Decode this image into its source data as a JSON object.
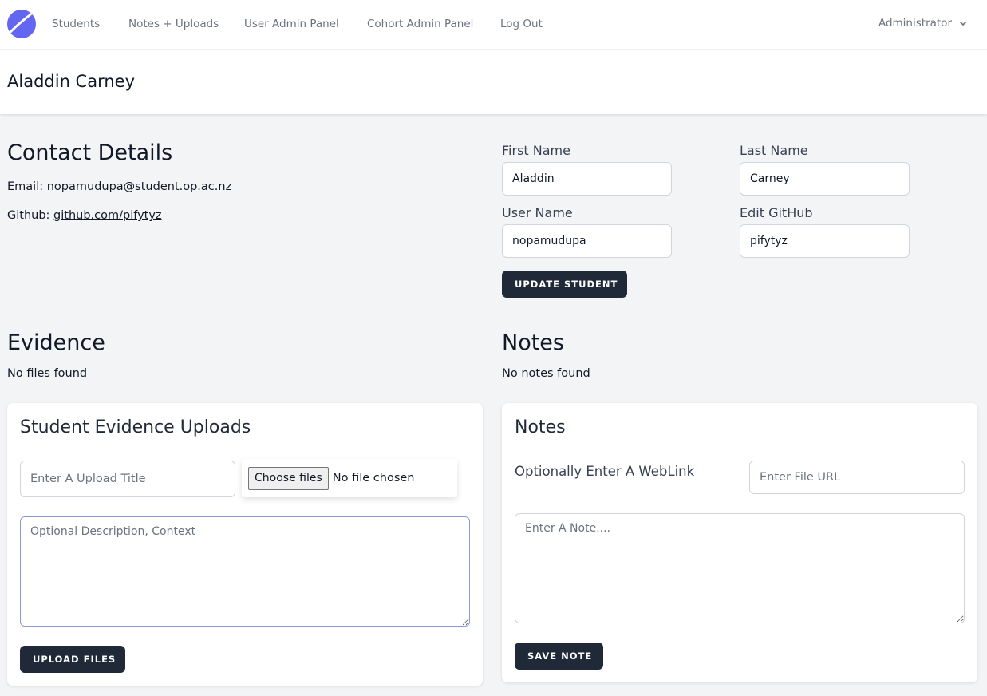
{
  "nav": {
    "links": [
      "Students",
      "Notes + Uploads",
      "User Admin Panel",
      "Cohort Admin Panel",
      "Log Out"
    ],
    "user": "Administrator",
    "logo_icon": "moon-logo-icon",
    "brand_color": "#6366f1"
  },
  "page": {
    "title": "Aladdin Carney"
  },
  "contact": {
    "heading": "Contact Details",
    "email_label": "Email:",
    "email": "nopamudupa@student.op.ac.nz",
    "github_label": "Github:",
    "github": "github.com/pifytyz"
  },
  "student_form": {
    "first_name_label": "First Name",
    "first_name": "Aladdin",
    "last_name_label": "Last Name",
    "last_name": "Carney",
    "user_name_label": "User Name",
    "user_name": "nopamudupa",
    "github_label": "Edit GitHub",
    "github": "pifytyz",
    "update_button": "UPDATE STUDENT"
  },
  "evidence": {
    "heading": "Evidence",
    "empty": "No files found"
  },
  "notes": {
    "heading": "Notes",
    "empty": "No notes found"
  },
  "upload_card": {
    "title": "Student Evidence Uploads",
    "title_placeholder": "Enter A Upload Title",
    "file_button": "Choose files",
    "file_status": "No file chosen",
    "description_placeholder": "Optional Description, Context",
    "upload_button": "UPLOAD FILES"
  },
  "notes_card": {
    "title": "Notes",
    "weblink_label": "Optionally Enter A WebLink",
    "url_placeholder": "Enter File URL",
    "note_placeholder": "Enter A Note....",
    "save_button": "SAVE NOTE"
  },
  "colors": {
    "dark_button": "#1f2937",
    "background": "#f3f4f6"
  }
}
